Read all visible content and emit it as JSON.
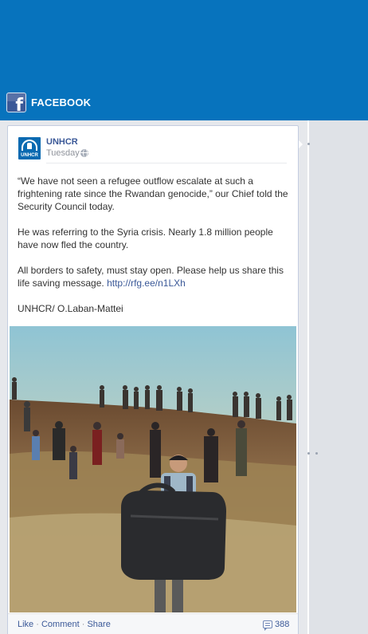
{
  "app": {
    "title": "FACEBOOK",
    "icon": "facebook-f-icon",
    "banner_color": "#0773bd"
  },
  "post": {
    "author": "UNHCR",
    "avatar_label": "UNHCR",
    "time": "Tuesday",
    "privacy_icon": "globe-icon",
    "paragraphs": [
      "“We have not seen a refugee outflow escalate at such a frightening rate since the Rwandan genocide,” our Chief told the Security Council today.",
      "He was referring to the Syria crisis. Nearly 1.8 million people have now fled the country."
    ],
    "paragraph3_text": "All borders to safety, must stay open. Please help us share this life saving message.",
    "link_text": "http://rfg.ee/n1LXh",
    "credit": "UNHCR/ O.Laban-Mattei",
    "photo_icon": "refugees-photo"
  },
  "footer": {
    "like": "Like",
    "comment": "Comment",
    "share": "Share",
    "separator": "·",
    "comment_icon": "comment-icon",
    "comment_count": "388"
  },
  "colors": {
    "link": "#3b5998",
    "timeline_bg": "#e6e8ec"
  }
}
